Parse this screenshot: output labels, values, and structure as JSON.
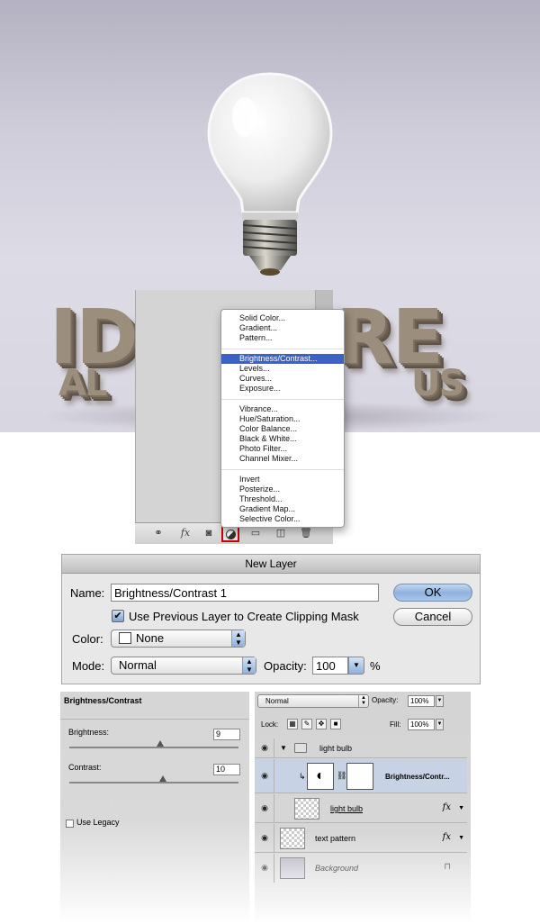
{
  "scene": {
    "headline_visible": [
      "ID",
      "RE"
    ],
    "subline_visible": [
      "AL",
      "US"
    ]
  },
  "adjustment_menu": {
    "groups": [
      [
        "Solid Color...",
        "Gradient...",
        "Pattern..."
      ],
      [
        "Brightness/Contrast...",
        "Levels...",
        "Curves...",
        "Exposure..."
      ],
      [
        "Vibrance...",
        "Hue/Saturation...",
        "Color Balance...",
        "Black & White...",
        "Photo Filter...",
        "Channel Mixer..."
      ],
      [
        "Invert",
        "Posterize...",
        "Threshold...",
        "Gradient Map...",
        "Selective Color..."
      ]
    ],
    "selected": "Brightness/Contrast..."
  },
  "layers_toolbar": {
    "icons": [
      "link-icon",
      "fx-icon",
      "mask-icon",
      "adjustment-layer-icon",
      "group-icon",
      "new-layer-icon",
      "trash-icon"
    ],
    "fx_label": "fx"
  },
  "dialog": {
    "title": "New Layer",
    "name_label": "Name:",
    "name_value": "Brightness/Contrast 1",
    "clip_label": "Use Previous Layer to Create Clipping Mask",
    "clip_checked": true,
    "color_label": "Color:",
    "color_value": "None",
    "mode_label": "Mode:",
    "mode_value": "Normal",
    "opacity_label": "Opacity:",
    "opacity_value": "100",
    "opacity_unit": "%",
    "ok_label": "OK",
    "cancel_label": "Cancel"
  },
  "bc_panel": {
    "title": "Brightness/Contrast",
    "brightness_label": "Brightness:",
    "brightness_value": "9",
    "contrast_label": "Contrast:",
    "contrast_value": "10",
    "legacy_label": "Use Legacy"
  },
  "layers_panel": {
    "blend_mode": "Normal",
    "opacity_label": "Opacity:",
    "opacity_value": "100%",
    "lock_label": "Lock:",
    "fill_label": "Fill:",
    "fill_value": "100%",
    "layers": [
      {
        "name": "light bulb",
        "kind": "group"
      },
      {
        "name": "Brightness/Contr...",
        "kind": "adjustment"
      },
      {
        "name": "light bulb",
        "kind": "layer",
        "fx": "fx"
      },
      {
        "name": "text pattern",
        "kind": "layer",
        "fx": "fx"
      },
      {
        "name": "Background",
        "kind": "background"
      }
    ]
  },
  "colors": {
    "menu_highlight": "#3b63c5",
    "selected_row": "#c7d3e4",
    "toolbar_highlight": "#d00000"
  }
}
